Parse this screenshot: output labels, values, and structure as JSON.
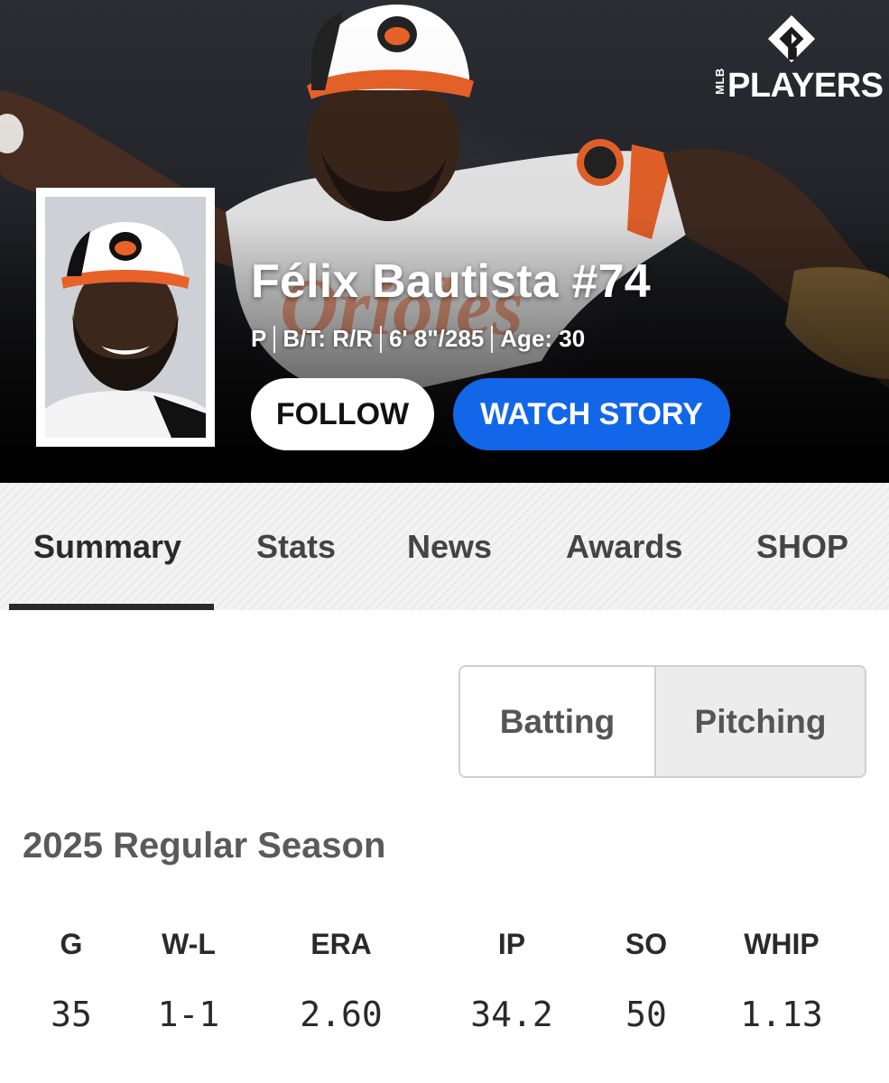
{
  "brand": {
    "mark_icon": "mlb-players-diamond-icon",
    "vertical_text": "MLB",
    "word": "PLAYERS"
  },
  "player": {
    "name": "Félix Bautista #74",
    "position": "P",
    "bats_throws": "B/T: R/R",
    "height_weight": "6' 8\"/285",
    "age": "Age: 30"
  },
  "actions": {
    "follow_label": "FOLLOW",
    "watch_story_label": "WATCH STORY"
  },
  "tabs": [
    {
      "label": "Summary",
      "active": true
    },
    {
      "label": "Stats",
      "active": false
    },
    {
      "label": "News",
      "active": false
    },
    {
      "label": "Awards",
      "active": false
    },
    {
      "label": "SHOP",
      "active": false
    }
  ],
  "segment": {
    "batting_label": "Batting",
    "pitching_label": "Pitching",
    "selected": "Pitching"
  },
  "season": {
    "title": "2025 Regular Season",
    "headers": [
      "G",
      "W-L",
      "ERA",
      "IP",
      "SO",
      "WHIP"
    ],
    "values": [
      "35",
      "1-1",
      "2.60",
      "34.2",
      "50",
      "1.13"
    ]
  },
  "colors": {
    "accent_blue": "#1266e8",
    "orioles_orange": "#e8622a"
  }
}
